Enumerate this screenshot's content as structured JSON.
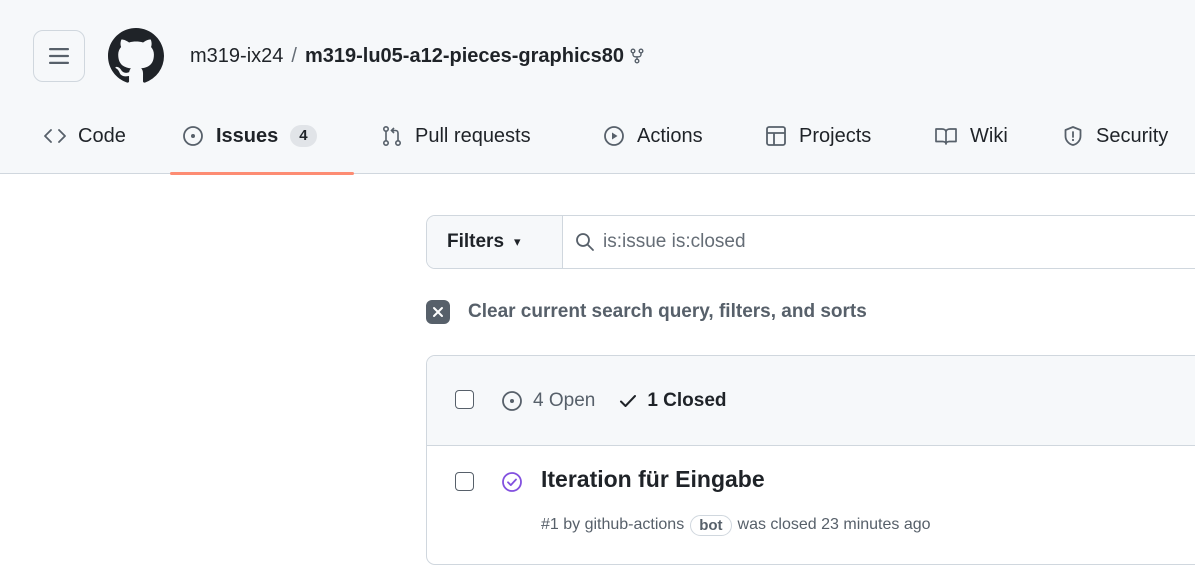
{
  "breadcrumb": {
    "owner": "m319-ix24",
    "separator": "/",
    "repo": "m319-lu05-a12-pieces-graphics80"
  },
  "tabs": [
    {
      "label": "Code",
      "icon": "code-icon"
    },
    {
      "label": "Issues",
      "icon": "issue-opened-icon",
      "count": "4",
      "active": true
    },
    {
      "label": "Pull requests",
      "icon": "git-pull-request-icon"
    },
    {
      "label": "Actions",
      "icon": "play-icon"
    },
    {
      "label": "Projects",
      "icon": "table-icon"
    },
    {
      "label": "Wiki",
      "icon": "book-icon"
    },
    {
      "label": "Security",
      "icon": "shield-icon"
    }
  ],
  "filters": {
    "button_label": "Filters",
    "search_value": "is:issue is:closed"
  },
  "clear_label": "Clear current search query, filters, and sorts",
  "issues_header": {
    "open_label": "4 Open",
    "closed_label": "1 Closed"
  },
  "issues": [
    {
      "title": "Iteration für Eingabe",
      "meta_prefix": "#1 by github-actions",
      "badge": "bot",
      "meta_suffix": "was closed 23 minutes ago",
      "state": "closed"
    }
  ],
  "colors": {
    "accent_underline": "#fd8c73",
    "closed_issue_purple": "#8250df",
    "header_bg": "#f6f8fa"
  }
}
